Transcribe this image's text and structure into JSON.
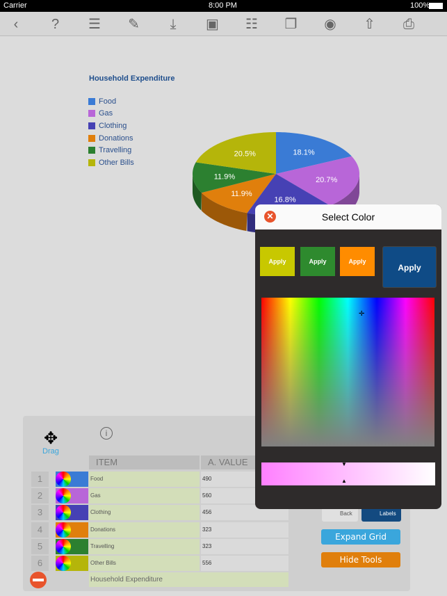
{
  "status": {
    "carrier": "Carrier",
    "time": "8:00 PM",
    "battery": "100%"
  },
  "toolbar": {
    "icons": [
      "back-icon",
      "help-icon",
      "list-icon",
      "edit-icon",
      "import-icon",
      "save-icon",
      "cabinet-icon",
      "windows-icon",
      "camera-icon",
      "share-icon",
      "print-icon"
    ],
    "glyphs": [
      "‹",
      "?",
      "☰",
      "✎",
      "⤓",
      "▣",
      "☷",
      "❐",
      "◉",
      "⇧",
      "⎙"
    ]
  },
  "chart_data": {
    "type": "pie",
    "title": "Household Expenditure",
    "categories": [
      "Food",
      "Gas",
      "Clothing",
      "Donations",
      "Travelling",
      "Other Bills"
    ],
    "values": [
      490,
      560,
      456,
      323,
      323,
      556
    ],
    "labels": [
      "18.1%",
      "20.7%",
      "16.8%",
      "11.9%",
      "11.9%",
      "20.5%"
    ],
    "colors": [
      "#3a7bd5",
      "#b866d8",
      "#4641b4",
      "#e07f0c",
      "#2c8030",
      "#b5b50a"
    ],
    "legend": "left",
    "style": "3d"
  },
  "popup": {
    "title": "Select Color",
    "swatches": [
      {
        "label": "Apply",
        "color": "#c8c800"
      },
      {
        "label": "Apply",
        "color": "#2e8a2e"
      },
      {
        "label": "Apply",
        "color": "#ff8c00"
      }
    ],
    "apply_big": "Apply"
  },
  "panel": {
    "drag": "Drag",
    "col_item": "ITEM",
    "col_value": "A.  VALUE",
    "rows": [
      {
        "n": "1",
        "item": "Food",
        "value": "490"
      },
      {
        "n": "2",
        "item": "Gas",
        "value": "560"
      },
      {
        "n": "3",
        "item": "Clothing",
        "value": "456"
      },
      {
        "n": "4",
        "item": "Donations",
        "value": "323"
      },
      {
        "n": "5",
        "item": "Travelling",
        "value": "323"
      },
      {
        "n": "6",
        "item": "Other Bills",
        "value": "556"
      }
    ],
    "chart_title_value": "Household Expenditure",
    "back": "Back",
    "labels": "Labels",
    "expand": "Expand Grid",
    "hide": "Hide Tools"
  }
}
